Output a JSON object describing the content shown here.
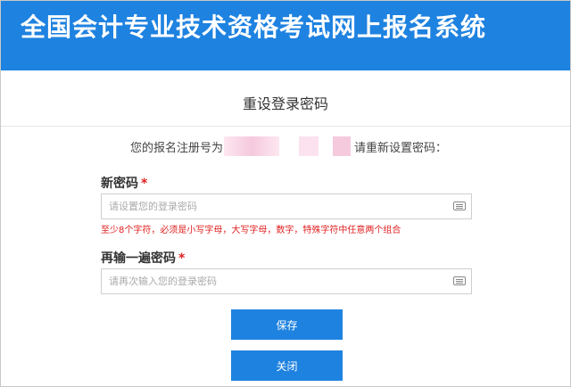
{
  "header": {
    "title": "全国会计专业技术资格考试网上报名系统"
  },
  "page": {
    "title": "重设登录密码"
  },
  "registration": {
    "prefix": "您的报名注册号为：",
    "suffix": "请重新设置密码："
  },
  "new_password": {
    "label": "新密码",
    "required_mark": "*",
    "placeholder": "请设置您的登录密码",
    "value": "",
    "hint": "至少8个字符，必须是小写字母，大写字母，数字，特殊字符中任意两个组合"
  },
  "confirm_password": {
    "label": "再输一遍密码",
    "required_mark": "*",
    "placeholder": "请再次输入您的登录密码",
    "value": ""
  },
  "buttons": {
    "save": "保存",
    "close": "关闭"
  },
  "colors": {
    "primary": "#1e82e0",
    "error": "#e02020"
  }
}
